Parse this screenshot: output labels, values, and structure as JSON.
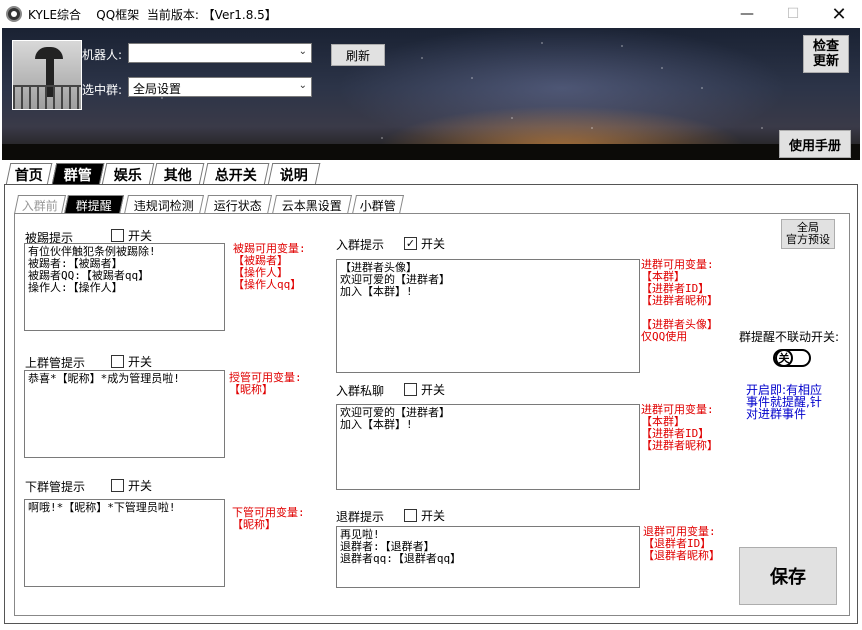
{
  "window": {
    "title": "KYLE综合    QQ框架  当前版本: 【Ver1.8.5】",
    "minimize": "—",
    "maximize": "☐",
    "close": "✕"
  },
  "header": {
    "robot_label": "机器人:",
    "robot_value": "",
    "refresh_button": "刷新",
    "group_label": "选中群:",
    "group_value": "全局设置",
    "check_update_button": "检查\n更新",
    "manual_button": "使用手册"
  },
  "main_tabs": [
    "首页",
    "群管",
    "娱乐",
    "其他",
    "总开关",
    "说明"
  ],
  "main_tabs_active": "群管",
  "sub_tabs": [
    "入群前",
    "群提醒",
    "违规词检测",
    "运行状态",
    "云本黑设置",
    "小群管"
  ],
  "sub_tabs_active": "群提醒",
  "switch_label": "开关",
  "kick": {
    "label": "被踢提示",
    "checked": false,
    "text": "有位伙伴触犯条例被踢除!\n被踢者:【被踢者】\n被踢者QQ:【被踢者qq】\n操作人:【操作人】",
    "vars": "被踢可用变量:\n【被踢者】\n【操作人】\n【操作人qq】"
  },
  "promote": {
    "label": "上群管提示",
    "checked": false,
    "text": "恭喜*【昵称】*成为管理员啦!",
    "vars": "授管可用变量:\n【昵称】"
  },
  "demote": {
    "label": "下群管提示",
    "checked": false,
    "text": "啊哦!*【昵称】*下管理员啦!",
    "vars": "下管可用变量:\n【昵称】"
  },
  "join": {
    "label": "入群提示",
    "checked": true,
    "text": "【进群者头像】\n欢迎可爱的【进群者】\n加入【本群】!",
    "vars": "进群可用变量:\n【本群】\n【进群者ID】\n【进群者昵称】\n\n【进群者头像】\n仅QQ使用"
  },
  "join_private": {
    "label": "入群私聊",
    "checked": false,
    "text": "欢迎可爱的【进群者】\n加入【本群】!",
    "vars": "进群可用变量:\n【本群】\n【进群者ID】\n【进群者昵称】"
  },
  "leave": {
    "label": "退群提示",
    "checked": false,
    "text": "再见啦!\n退群者:【退群者】\n退群者qq:【退群者qq】",
    "vars": "退群可用变量:\n【退群者ID】\n【退群者昵称】"
  },
  "right": {
    "preset_button": "全局\n官方预设",
    "nolink_label": "群提醒不联动开关:",
    "toggle_state": "关",
    "note": "开启即:有相应\n事件就提醒,针\n对进群事件",
    "save_button": "保存"
  },
  "colors": {
    "var_red": "#e00000",
    "note_blue": "#0000cc"
  }
}
